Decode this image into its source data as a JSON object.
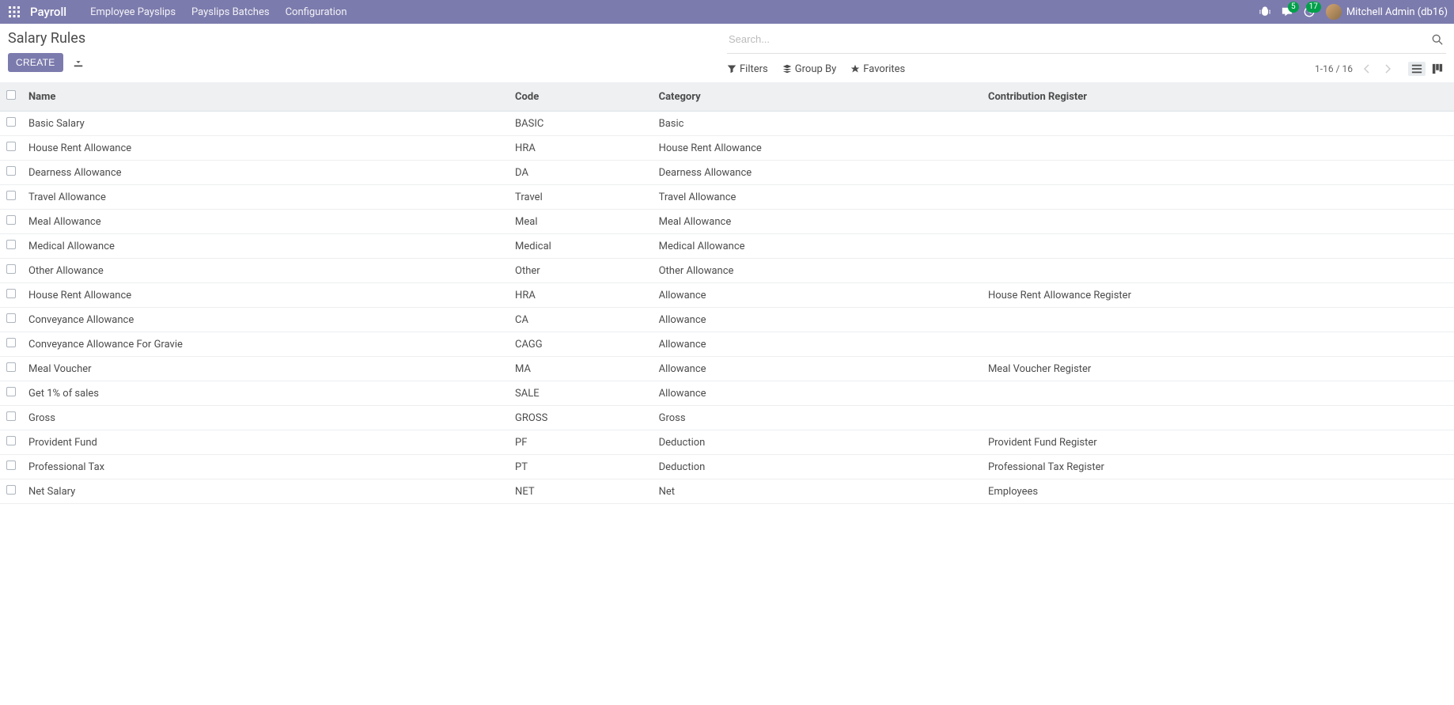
{
  "navbar": {
    "brand": "Payroll",
    "items": [
      "Employee Payslips",
      "Payslips Batches",
      "Configuration"
    ],
    "messages_badge": "5",
    "activity_badge": "17",
    "user": "Mitchell Admin (db16)"
  },
  "header": {
    "title": "Salary Rules",
    "create_label": "CREATE"
  },
  "search": {
    "placeholder": "Search..."
  },
  "toolbar": {
    "filters_label": "Filters",
    "groupby_label": "Group By",
    "favorites_label": "Favorites",
    "pager": "1-16 / 16"
  },
  "table": {
    "headers": {
      "name": "Name",
      "code": "Code",
      "category": "Category",
      "register": "Contribution Register"
    },
    "rows": [
      {
        "name": "Basic Salary",
        "code": "BASIC",
        "category": "Basic",
        "register": ""
      },
      {
        "name": "House Rent Allowance",
        "code": "HRA",
        "category": "House Rent Allowance",
        "register": ""
      },
      {
        "name": "Dearness Allowance",
        "code": "DA",
        "category": "Dearness Allowance",
        "register": ""
      },
      {
        "name": "Travel Allowance",
        "code": "Travel",
        "category": "Travel Allowance",
        "register": ""
      },
      {
        "name": "Meal Allowance",
        "code": "Meal",
        "category": "Meal Allowance",
        "register": ""
      },
      {
        "name": "Medical Allowance",
        "code": "Medical",
        "category": "Medical Allowance",
        "register": ""
      },
      {
        "name": "Other Allowance",
        "code": "Other",
        "category": "Other Allowance",
        "register": ""
      },
      {
        "name": "House Rent Allowance",
        "code": "HRA",
        "category": "Allowance",
        "register": "House Rent Allowance Register"
      },
      {
        "name": "Conveyance Allowance",
        "code": "CA",
        "category": "Allowance",
        "register": ""
      },
      {
        "name": "Conveyance Allowance For Gravie",
        "code": "CAGG",
        "category": "Allowance",
        "register": ""
      },
      {
        "name": "Meal Voucher",
        "code": "MA",
        "category": "Allowance",
        "register": "Meal Voucher Register"
      },
      {
        "name": "Get 1% of sales",
        "code": "SALE",
        "category": "Allowance",
        "register": ""
      },
      {
        "name": "Gross",
        "code": "GROSS",
        "category": "Gross",
        "register": ""
      },
      {
        "name": "Provident Fund",
        "code": "PF",
        "category": "Deduction",
        "register": "Provident Fund Register"
      },
      {
        "name": "Professional Tax",
        "code": "PT",
        "category": "Deduction",
        "register": "Professional Tax Register"
      },
      {
        "name": "Net Salary",
        "code": "NET",
        "category": "Net",
        "register": "Employees"
      }
    ]
  }
}
